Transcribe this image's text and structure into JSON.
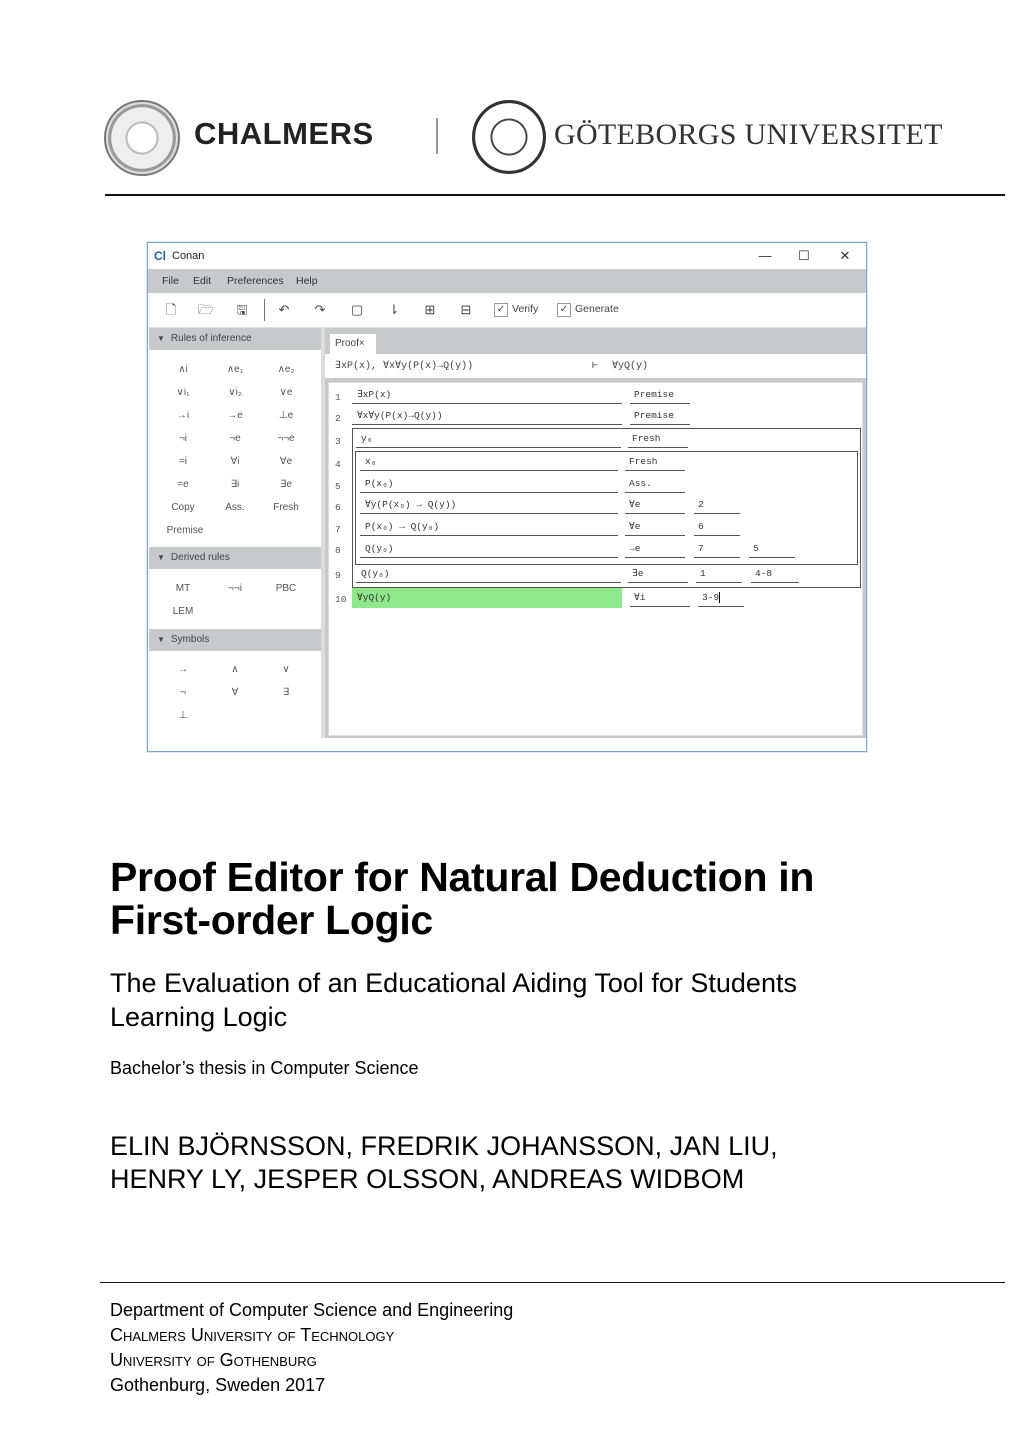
{
  "header": {
    "logo_left_text": "CHALMERS",
    "logo_right_text": "GÖTEBORGS UNIVERSITET"
  },
  "app": {
    "title": "Conan",
    "icon": "Cl",
    "window_controls": {
      "minimize": "—",
      "maximize": "☐",
      "close": "✕"
    },
    "menu": [
      "File",
      "Edit",
      "Preferences",
      "Help"
    ],
    "toolbar": {
      "icons": [
        "new-file",
        "open-folder",
        "save",
        "undo",
        "redo",
        "box",
        "sort",
        "expand",
        "collapse"
      ],
      "glyphs": [
        "🗋",
        "🗁",
        "🖫",
        "↶",
        "↷",
        "▢",
        "⇂",
        "⊞",
        "⊟"
      ],
      "verify_label": "Verify",
      "verify_checked": true,
      "generate_label": "Generate",
      "generate_checked": true
    },
    "left_panel": {
      "sections": [
        {
          "title": "Rules of inference",
          "rows": [
            [
              "∧i",
              "∧e₁",
              "∧e₂"
            ],
            [
              "∨i₁",
              "∨i₂",
              "∨e"
            ],
            [
              "→i",
              "→e",
              "⊥e"
            ],
            [
              "¬i",
              "¬e",
              "¬¬e"
            ],
            [
              "=i",
              "∀i",
              "∀e"
            ],
            [
              "=e",
              "∃i",
              "∃e"
            ],
            [
              "Copy",
              "Ass.",
              "Fresh"
            ],
            [
              "Premise"
            ]
          ]
        },
        {
          "title": "Derived rules",
          "rows": [
            [
              "MT",
              "¬¬i",
              "PBC"
            ],
            [
              "LEM"
            ]
          ]
        },
        {
          "title": "Symbols",
          "rows": [
            [
              "→",
              "∧",
              "∨"
            ],
            [
              "¬",
              "∀",
              "∃"
            ],
            [
              "⊥"
            ]
          ]
        }
      ]
    },
    "proof": {
      "tab_label": "Proof",
      "tab_close": "×",
      "premises": "∃xP(x), ∀x∀y(P(x)→Q(y))",
      "turnstile": "⊢",
      "conclusion": "∀yQ(y)",
      "lines": [
        {
          "n": "1",
          "formula": "∃xP(x)",
          "rule": "Premise",
          "ref1": "",
          "ref2": ""
        },
        {
          "n": "2",
          "formula": "∀x∀y(P(x)→Q(y))",
          "rule": "Premise",
          "ref1": "",
          "ref2": ""
        },
        {
          "n": "3",
          "formula": "y₀",
          "rule": "Fresh",
          "ref1": "",
          "ref2": ""
        },
        {
          "n": "4",
          "formula": "x₀",
          "rule": "Fresh",
          "ref1": "",
          "ref2": ""
        },
        {
          "n": "5",
          "formula": "P(x₀)",
          "rule": "Ass.",
          "ref1": "",
          "ref2": ""
        },
        {
          "n": "6",
          "formula": "∀y(P(x₀) → Q(y))",
          "rule": "∀e",
          "ref1": "2",
          "ref2": ""
        },
        {
          "n": "7",
          "formula": "P(x₀) → Q(y₀)",
          "rule": "∀e",
          "ref1": "6",
          "ref2": ""
        },
        {
          "n": "8",
          "formula": "Q(y₀)",
          "rule": "→e",
          "ref1": "7",
          "ref2": "5"
        },
        {
          "n": "9",
          "formula": "Q(y₀)",
          "rule": "∃e",
          "ref1": "1",
          "ref2": "4-8"
        },
        {
          "n": "10",
          "formula": "∀yQ(y)",
          "rule": "∀i",
          "ref1": "3-9",
          "ref2": ""
        }
      ],
      "highlight_color": "#8fe88c"
    }
  },
  "document": {
    "title_line1": "Proof Editor for Natural Deduction in",
    "title_line2": "First-order Logic",
    "subtitle_line1": "The Evaluation of an Educational Aiding Tool for Students",
    "subtitle_line2": "Learning Logic",
    "degree": "Bachelor’s thesis in Computer Science",
    "authors_line1": "ELIN BJÖRNSSON, FREDRIK JOHANSSON, JAN LIU,",
    "authors_line2": "HENRY LY, JESPER OLSSON, ANDREAS WIDBOM",
    "footer": {
      "department": "Department of Computer Science and Engineering",
      "university1": "Chalmers University of Technology",
      "university2": "University of Gothenburg",
      "location": "Gothenburg, Sweden 2017"
    }
  }
}
